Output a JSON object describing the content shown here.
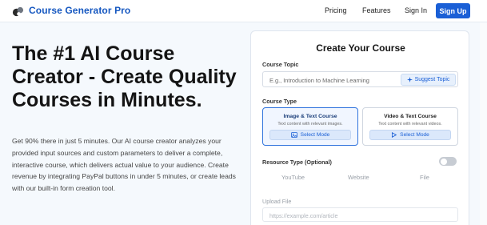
{
  "nav": {
    "brand": "Course Generator Pro",
    "links": [
      "Pricing",
      "Features",
      "Sign In"
    ],
    "signup_label": "Sign Up"
  },
  "hero": {
    "title": "The #1 AI Course Creator - Create Quality Courses in Minutes.",
    "description": "Get 90% there in just 5 minutes. Our AI course creator analyzes your provided input sources and custom parameters to deliver a complete, interactive course, which delivers actual value to your audience. Create revenue by integrating PayPal buttons in under 5 minutes, or create leads with our built-in form creation tool."
  },
  "form": {
    "title": "Create Your Course",
    "topic_label": "Course Topic",
    "topic_placeholder": "E.g., Introduction to Machine Learning",
    "suggest_label": "Suggest Topic",
    "type_label": "Course Type",
    "types": [
      {
        "title": "Image & Text Course",
        "subtitle": "Text content with relevant images.",
        "button": "Select Mode",
        "selected": true
      },
      {
        "title": "Video & Text Course",
        "subtitle": "Text content with relevant videos.",
        "button": "Select Mode",
        "selected": false
      }
    ],
    "resource_label": "Resource Type (Optional)",
    "resource_toggle_on": false,
    "resource_tabs": [
      "YouTube",
      "Website",
      "File"
    ],
    "upload_label": "Upload File",
    "upload_placeholder": "https://example.com/article"
  },
  "colors": {
    "accent": "#1a5fd6",
    "brand_text": "#1557c0",
    "page_bg": "#f5f9fd"
  },
  "icons": {
    "logo": "logo-icon",
    "suggest": "sparkle-icon",
    "image_mode": "image-icon",
    "video_mode": "play-icon"
  }
}
